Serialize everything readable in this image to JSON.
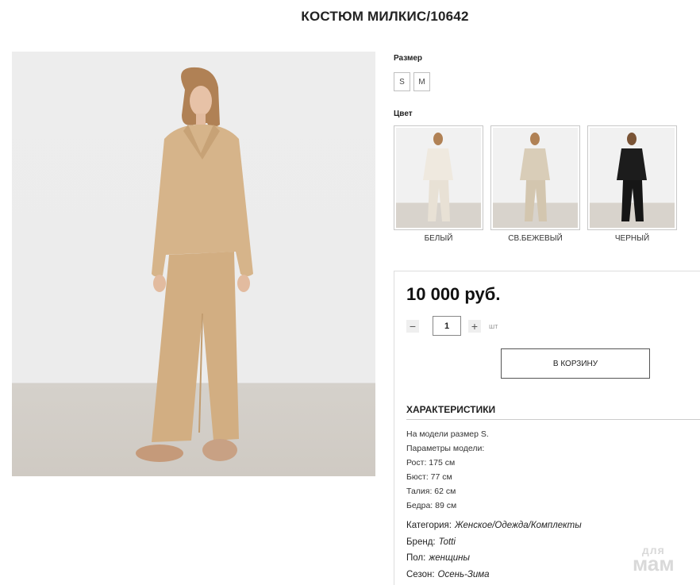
{
  "product": {
    "title": "КОСТЮМ МИЛКИС/10642"
  },
  "size": {
    "label": "Размер",
    "options": [
      "S",
      "M"
    ]
  },
  "color": {
    "label": "Цвет",
    "options": [
      {
        "name": "БЕЛЫЙ",
        "tone": "#efe9df"
      },
      {
        "name": "СВ.БЕЖЕВЫЙ",
        "tone": "#d9cdb8"
      },
      {
        "name": "ЧЕРНЫЙ",
        "tone": "#1c1c1c"
      }
    ]
  },
  "purchase": {
    "price": "10 000 руб.",
    "qty_minus": "−",
    "qty_value": "1",
    "qty_plus": "+",
    "qty_unit": "шт",
    "cart_button": "В КОРЗИНУ"
  },
  "characteristics": {
    "heading": "ХАРАКТЕРИСТИКИ",
    "description": [
      "На модели размер S.",
      "Параметры модели:",
      "Рост: 175 см",
      "Бюст: 77 см",
      "Талия: 62 см",
      "Бедра: 89 см"
    ],
    "attributes": [
      {
        "key": "Категория:",
        "value": "Женское/Одежда/Комплекты"
      },
      {
        "key": "Бренд:",
        "value": "Totti"
      },
      {
        "key": "Пол:",
        "value": "женщины"
      },
      {
        "key": "Сезон:",
        "value": "Осень-Зима"
      }
    ]
  },
  "watermark": {
    "top": "для",
    "bottom": "мам"
  },
  "colors": {
    "suit_main": "#d6b48a",
    "suit_shadow": "#c7a276",
    "accent_border": "#888888"
  }
}
